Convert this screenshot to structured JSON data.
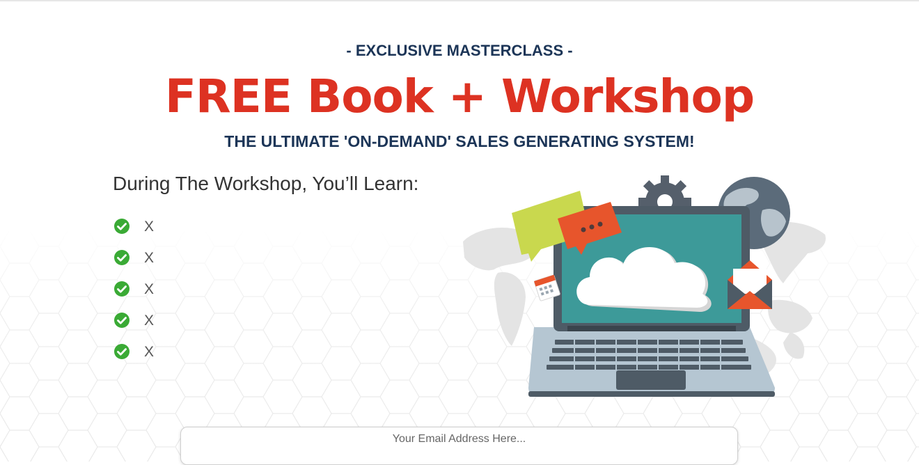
{
  "header": {
    "eyebrow": "- EXCLUSIVE MASTERCLASS -",
    "headline": "FREE Book + Workshop",
    "subheadline": "THE ULTIMATE 'ON-DEMAND' SALES GENERATING SYSTEM!"
  },
  "learn": {
    "heading": "During The Workshop, You’ll Learn:",
    "items": [
      {
        "icon": "check-circle-icon",
        "text": "X"
      },
      {
        "icon": "check-circle-icon",
        "text": "X"
      },
      {
        "icon": "check-circle-icon",
        "text": "X"
      },
      {
        "icon": "check-circle-icon",
        "text": "X"
      },
      {
        "icon": "check-circle-icon",
        "text": "X"
      }
    ]
  },
  "form": {
    "email_placeholder": "Your Email Address Here..."
  },
  "colors": {
    "headline_red": "#dd3222",
    "navy": "#1c3557",
    "check_green": "#3aaa35"
  }
}
